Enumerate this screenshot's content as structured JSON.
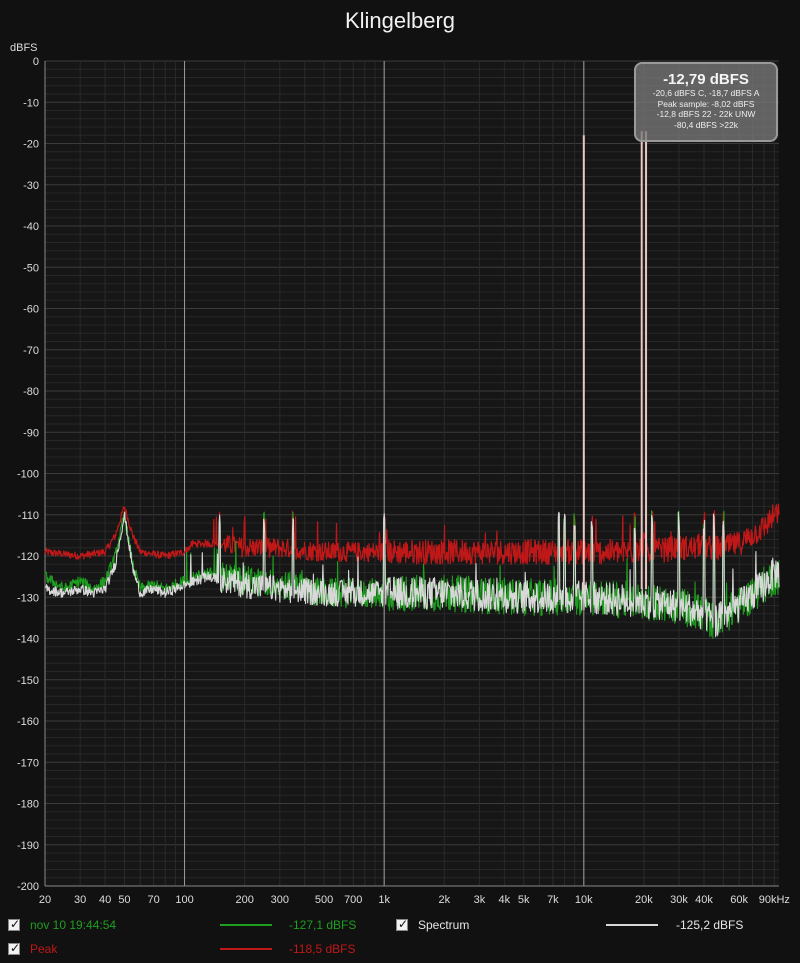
{
  "title": "Klingelberg",
  "y_unit": "dBFS",
  "readout": {
    "main": "-12,79 dBFS",
    "lines": [
      "-20,6 dBFS C, -18,7 dBFS A",
      "Peak sample: -8,02 dBFS",
      "-12,8 dBFS 22 - 22k UNW",
      "-80,4 dBFS >22k"
    ]
  },
  "legend": {
    "trace1": {
      "label": "nov 10 19:44:54",
      "color": "#1e9e1e",
      "value": "-127,1 dBFS",
      "checked": true
    },
    "trace2": {
      "label": "Spectrum",
      "color": "#d8d8d8",
      "value": "-125,2 dBFS",
      "checked": true
    },
    "trace3": {
      "label": "Peak",
      "color": "#c01818",
      "value": "-118,5 dBFS",
      "checked": true
    }
  },
  "chart_data": {
    "type": "line",
    "title": "Klingelberg",
    "ylabel": "dBFS",
    "xscale": "log",
    "xlim": [
      20,
      95000
    ],
    "ylim": [
      -200,
      0
    ],
    "yticks": [
      0,
      -10,
      -20,
      -30,
      -40,
      -50,
      -60,
      -70,
      -80,
      -90,
      -100,
      -110,
      -120,
      -130,
      -140,
      -150,
      -160,
      -170,
      -180,
      -190,
      -200
    ],
    "xticks": [
      {
        "v": 20,
        "label": "20"
      },
      {
        "v": 30,
        "label": "30"
      },
      {
        "v": 40,
        "label": "40"
      },
      {
        "v": 50,
        "label": "50"
      },
      {
        "v": 70,
        "label": "70"
      },
      {
        "v": 100,
        "label": "100"
      },
      {
        "v": 200,
        "label": "200"
      },
      {
        "v": 300,
        "label": "300"
      },
      {
        "v": 500,
        "label": "500"
      },
      {
        "v": 700,
        "label": "700"
      },
      {
        "v": 1000,
        "label": "1k"
      },
      {
        "v": 2000,
        "label": "2k"
      },
      {
        "v": 3000,
        "label": "3k"
      },
      {
        "v": 4000,
        "label": "4k"
      },
      {
        "v": 5000,
        "label": "5k"
      },
      {
        "v": 7000,
        "label": "7k"
      },
      {
        "v": 10000,
        "label": "10k"
      },
      {
        "v": 20000,
        "label": "20k"
      },
      {
        "v": 30000,
        "label": "30k"
      },
      {
        "v": 40000,
        "label": "40k"
      },
      {
        "v": 60000,
        "label": "60k"
      },
      {
        "v": 90000,
        "label": "90kHz"
      }
    ],
    "grid": true,
    "markers_hz": [
      100,
      1000,
      10000
    ],
    "series": [
      {
        "name": "Peak",
        "color": "#c01818",
        "x": [
          20,
          30,
          40,
          45,
          50,
          55,
          60,
          80,
          100,
          110,
          150,
          200,
          300,
          500,
          1000,
          2000,
          5000,
          10000,
          19000,
          20000,
          21000,
          30000,
          40000,
          50000,
          60000,
          80000,
          90000
        ],
        "y": [
          -119,
          -120,
          -119,
          -115,
          -108,
          -115,
          -119,
          -120,
          -119,
          -117,
          -117,
          -118,
          -118,
          -119,
          -119,
          -119,
          -119,
          -119,
          -119,
          -117,
          -119,
          -118,
          -118,
          -118,
          -117,
          -113,
          -110
        ]
      },
      {
        "name": "nov 10 19:44:54",
        "color": "#1e9e1e",
        "x": [
          20,
          25,
          30,
          35,
          40,
          45,
          50,
          55,
          60,
          70,
          80,
          100,
          130,
          200,
          300,
          500,
          1000,
          2000,
          5000,
          10000,
          20000,
          30000,
          40000,
          45000,
          60000,
          80000,
          90000
        ],
        "y": [
          -125,
          -128,
          -126,
          -128,
          -126,
          -120,
          -110,
          -122,
          -128,
          -127,
          -128,
          -126,
          -124,
          -126,
          -127,
          -129,
          -129,
          -129,
          -130,
          -130,
          -131,
          -132,
          -134,
          -136,
          -132,
          -127,
          -125
        ]
      },
      {
        "name": "Spectrum",
        "color": "#d8d8d8",
        "x": [
          20,
          25,
          30,
          35,
          40,
          45,
          50,
          55,
          60,
          70,
          80,
          100,
          130,
          200,
          300,
          500,
          1000,
          2000,
          5000,
          10000,
          20000,
          30000,
          40000,
          45000,
          60000,
          80000,
          90000
        ],
        "y": [
          -128,
          -129,
          -128,
          -129,
          -128,
          -122,
          -110,
          -123,
          -129,
          -128,
          -129,
          -127,
          -125,
          -127,
          -128,
          -129,
          -129,
          -129,
          -130,
          -130,
          -131,
          -132,
          -134,
          -136,
          -132,
          -127,
          -124
        ]
      }
    ],
    "spikes": [
      {
        "x": 10000,
        "y": -18
      },
      {
        "x": 19500,
        "y": -17
      },
      {
        "x": 20500,
        "y": -17
      }
    ]
  }
}
